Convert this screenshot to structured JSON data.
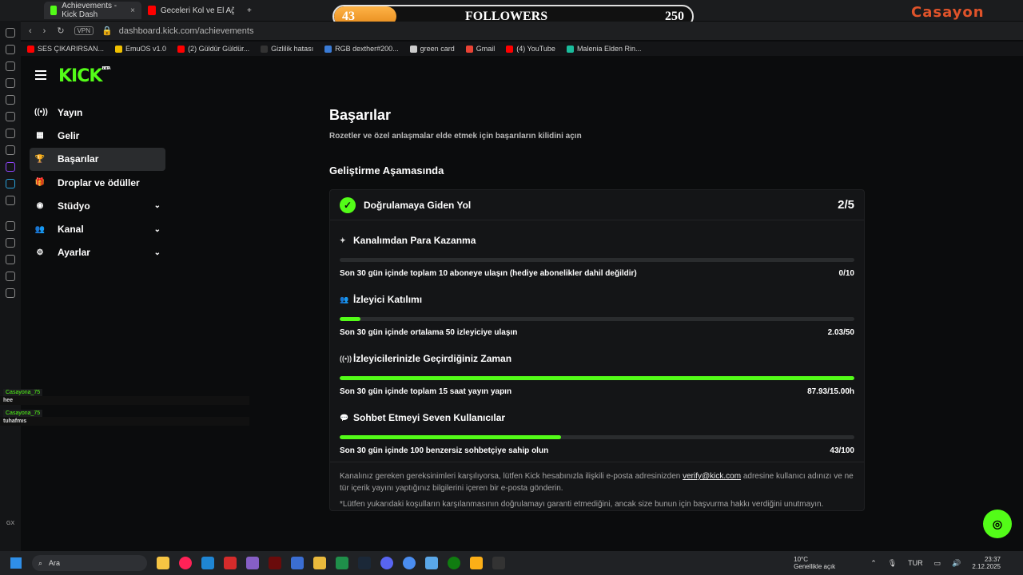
{
  "browser": {
    "tabs": [
      {
        "label": "Achievements - Kick Dash",
        "favicon_color": "#53fc18"
      },
      {
        "label": "Geceleri Kol ve El Ağrısıy",
        "favicon_color": "#ff0000"
      }
    ],
    "url": "dashboard.kick.com/achievements",
    "url_prefix": "VPN",
    "bookmarks": [
      {
        "label": "SES ÇIKARIRSAN...",
        "color": "#ff0000"
      },
      {
        "label": "EmuOS v1.0",
        "color": "#f0c000"
      },
      {
        "label": "(2) Güldür Güldür...",
        "color": "#ff0000"
      },
      {
        "label": "Gizlilik hatası",
        "color": "#333333"
      },
      {
        "label": "RGB dexther#200...",
        "color": "#3a7bd5"
      },
      {
        "label": "green card",
        "color": "#cccccc"
      },
      {
        "label": "Gmail",
        "color": "#ea4335"
      },
      {
        "label": "(4) YouTube",
        "color": "#ff0000"
      },
      {
        "label": "Malenia Elden Rin...",
        "color": "#1abc9c"
      }
    ]
  },
  "overlay": {
    "followers_current": "43",
    "followers_label": "FOLLOWERS",
    "followers_goal": "250",
    "progress": 0.172,
    "brand": "Casayon"
  },
  "sidebar": {
    "logo": "KICK",
    "logo_badge": "BETA",
    "items": [
      {
        "label": "Yayın",
        "icon": "((•))",
        "chevron": false
      },
      {
        "label": "Gelir",
        "icon": "▦",
        "chevron": false
      },
      {
        "label": "Başarılar",
        "icon": "🏆",
        "chevron": false,
        "active": true
      },
      {
        "label": "Droplar ve ödüller",
        "icon": "🎁",
        "chevron": false
      },
      {
        "label": "Stüdyo",
        "icon": "◉",
        "chevron": true
      },
      {
        "label": "Kanal",
        "icon": "👥",
        "chevron": true
      },
      {
        "label": "Ayarlar",
        "icon": "⚙",
        "chevron": true
      }
    ]
  },
  "chat": [
    {
      "user": "Casayona_75",
      "message": "hee"
    },
    {
      "user": "Casayona_75",
      "message": "tuhafmıs"
    }
  ],
  "page": {
    "title": "Başarılar",
    "subtitle": "Rozetler ve özel anlaşmalar elde etmek için başarıların kilidini açın",
    "section_title": "Geliştirme Aşamasında",
    "card": {
      "title": "Doğrulamaya Giden Yol",
      "count": "2/5",
      "tasks": [
        {
          "title": "Kanalımdan Para Kazanma",
          "icon": "✦",
          "desc": "Son 30 gün içinde toplam 10 aboneye ulaşın (hediye abonelikler dahil değildir)",
          "value": "0/10",
          "progress": 0.0
        },
        {
          "title": "İzleyici Katılımı",
          "icon": "👥",
          "desc": "Son 30 gün içinde ortalama 50 izleyiciye ulaşın",
          "value": "2.03/50",
          "progress": 0.04
        },
        {
          "title": "İzleyicilerinizle Geçirdiğiniz Zaman",
          "icon": "((•))",
          "desc": "Son 30 gün içinde toplam 15 saat yayın yapın",
          "value": "87.93/15.00h",
          "progress": 1.0
        },
        {
          "title": "Sohbet Etmeyi Seven Kullanıcılar",
          "icon": "💬",
          "desc": "Son 30 gün içinde 100 benzersiz sohbetçiye sahip olun",
          "value": "43/100",
          "progress": 0.43
        }
      ],
      "note1_a": "Kanalınız gereken gereksinimleri karşılıyorsa, lütfen Kick hesabınızla ilişkili e-posta adresinizden",
      "note1_link": "verify@kick.com",
      "note1_b": "adresine kullanıcı adınızı ve ne tür içerik yayını yaptığınız bilgilerini içeren bir e-posta gönderin.",
      "note2": "*Lütfen yukarıdaki koşulların karşılanmasının doğrulamayı garanti etmediğini, ancak size bunun için başvurma hakkı verdiğini unutmayın."
    }
  },
  "taskbar": {
    "search_placeholder": "Ara",
    "weather_temp": "10°C",
    "weather_desc": "Genellikle açık",
    "lang": "TUR",
    "time": "23:37",
    "date": "2.12.2025",
    "rail_label": "GX"
  }
}
